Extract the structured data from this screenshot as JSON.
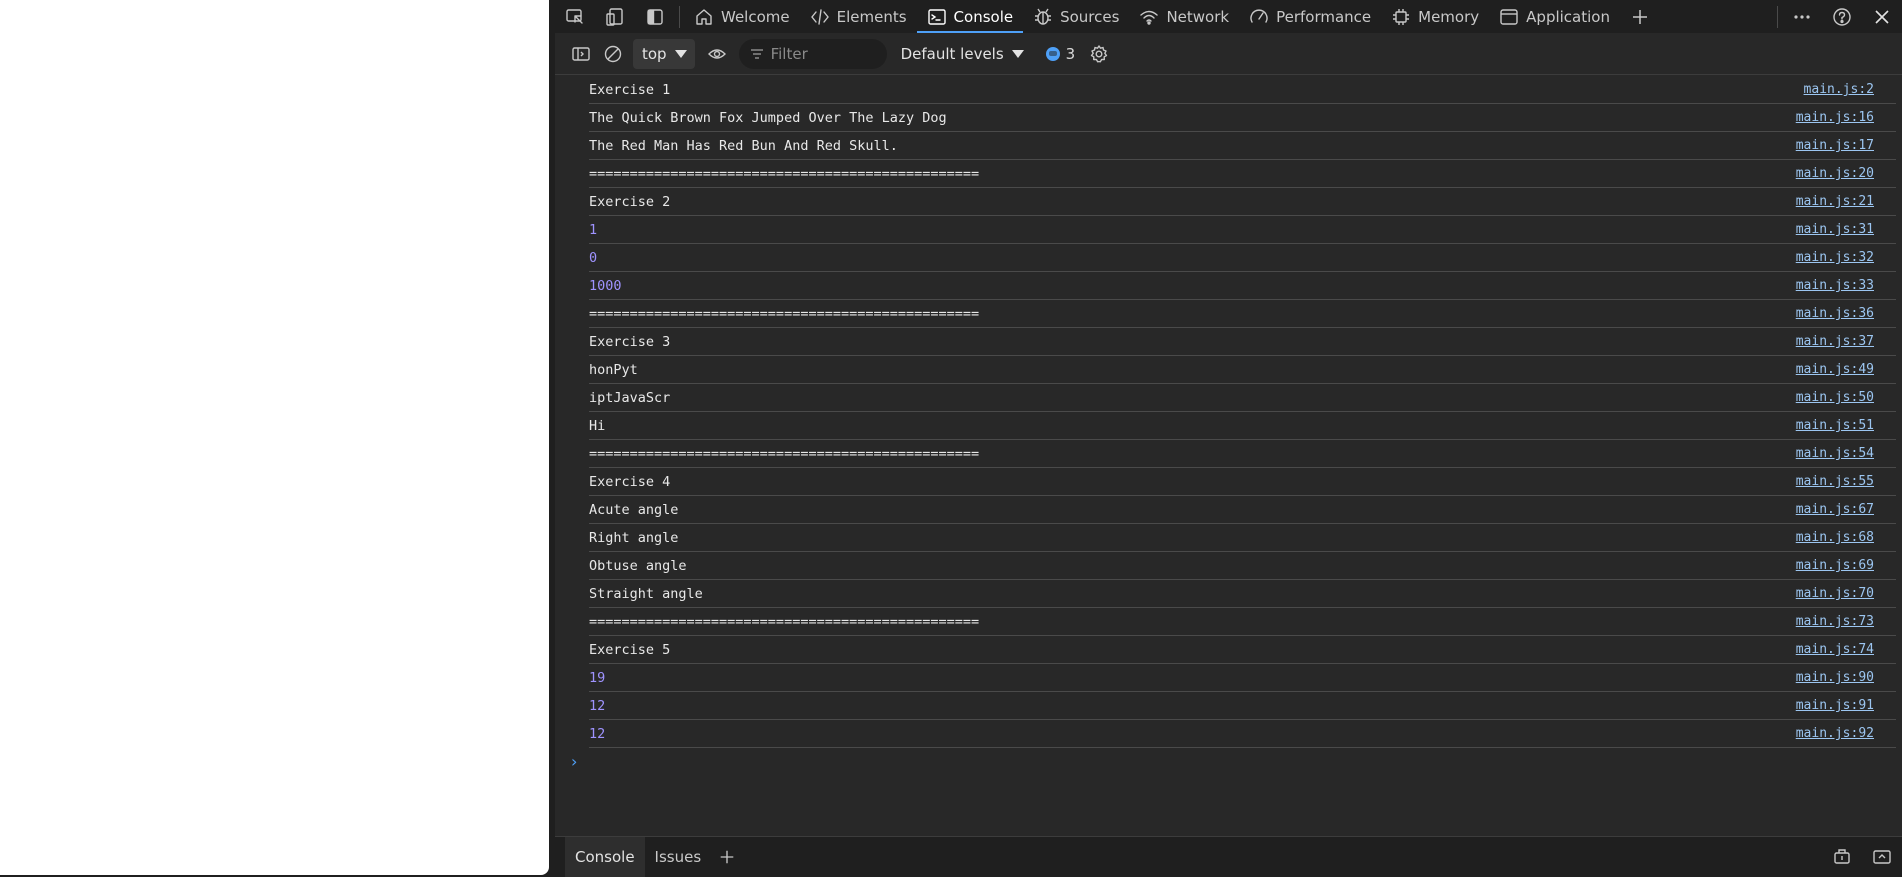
{
  "tabs": [
    {
      "label": "Welcome",
      "icon": "home-icon"
    },
    {
      "label": "Elements",
      "icon": "code-icon"
    },
    {
      "label": "Console",
      "icon": "console-icon",
      "active": true
    },
    {
      "label": "Sources",
      "icon": "bug-icon"
    },
    {
      "label": "Network",
      "icon": "wifi-icon"
    },
    {
      "label": "Performance",
      "icon": "gauge-icon"
    },
    {
      "label": "Memory",
      "icon": "chip-icon"
    },
    {
      "label": "Application",
      "icon": "window-icon"
    }
  ],
  "toolbar": {
    "context": "top",
    "filter_placeholder": "Filter",
    "levels": "Default levels",
    "issues_count": "3"
  },
  "logs": [
    {
      "text": "Exercise 1",
      "source": "main.js:2",
      "kind": "string"
    },
    {
      "text": "The Quick Brown Fox Jumped Over The Lazy Dog",
      "source": "main.js:16",
      "kind": "string"
    },
    {
      "text": "The Red Man Has Red Bun And Red Skull.",
      "source": "main.js:17",
      "kind": "string"
    },
    {
      "text": "================================================",
      "source": "main.js:20",
      "kind": "string"
    },
    {
      "text": "Exercise 2",
      "source": "main.js:21",
      "kind": "string"
    },
    {
      "text": "1",
      "source": "main.js:31",
      "kind": "number"
    },
    {
      "text": "0",
      "source": "main.js:32",
      "kind": "number"
    },
    {
      "text": "1000",
      "source": "main.js:33",
      "kind": "number"
    },
    {
      "text": "================================================",
      "source": "main.js:36",
      "kind": "string"
    },
    {
      "text": "Exercise 3",
      "source": "main.js:37",
      "kind": "string"
    },
    {
      "text": "honPyt",
      "source": "main.js:49",
      "kind": "string"
    },
    {
      "text": "iptJavaScr",
      "source": "main.js:50",
      "kind": "string"
    },
    {
      "text": "Hi",
      "source": "main.js:51",
      "kind": "string"
    },
    {
      "text": "================================================",
      "source": "main.js:54",
      "kind": "string"
    },
    {
      "text": "Exercise 4",
      "source": "main.js:55",
      "kind": "string"
    },
    {
      "text": "Acute angle",
      "source": "main.js:67",
      "kind": "string"
    },
    {
      "text": "Right angle",
      "source": "main.js:68",
      "kind": "string"
    },
    {
      "text": "Obtuse angle",
      "source": "main.js:69",
      "kind": "string"
    },
    {
      "text": "Straight angle",
      "source": "main.js:70",
      "kind": "string"
    },
    {
      "text": "================================================",
      "source": "main.js:73",
      "kind": "string"
    },
    {
      "text": "Exercise 5",
      "source": "main.js:74",
      "kind": "string"
    },
    {
      "text": "19",
      "source": "main.js:90",
      "kind": "number"
    },
    {
      "text": "12",
      "source": "main.js:91",
      "kind": "number"
    },
    {
      "text": "12",
      "source": "main.js:92",
      "kind": "number"
    }
  ],
  "drawer": {
    "console_label": "Console",
    "issues_label": "Issues"
  },
  "colors": {
    "accent": "#4ea0f7",
    "number_value": "#9f93ff",
    "link": "#9cc6f1",
    "panel_bg": "#282828",
    "bar_bg": "#1f1f1f"
  }
}
